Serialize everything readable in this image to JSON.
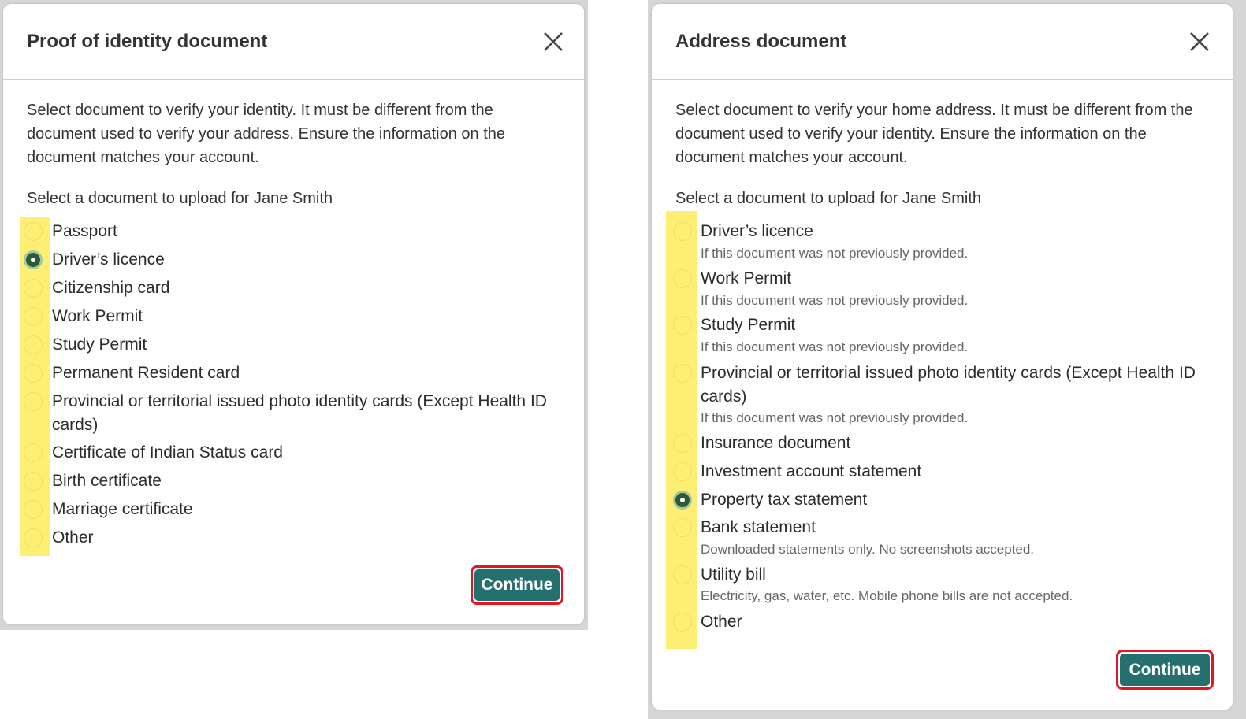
{
  "colors": {
    "highlight": "#fdef73",
    "primary_button": "#266f6f",
    "button_outline": "#e4161f",
    "radio_checked": "#2e5a38"
  },
  "identity_dialog": {
    "title": "Proof of identity document",
    "intro": "Select document to verify your identity. It must be different from the document used to verify your address. Ensure the information on the document matches your account.",
    "prompt": "Select a document to upload for Jane Smith",
    "options": [
      {
        "label": "Passport",
        "checked": false
      },
      {
        "label": "Driver’s licence",
        "checked": true
      },
      {
        "label": "Citizenship card",
        "checked": false
      },
      {
        "label": "Work Permit",
        "checked": false
      },
      {
        "label": "Study Permit",
        "checked": false
      },
      {
        "label": "Permanent Resident card",
        "checked": false
      },
      {
        "label": "Provincial or territorial issued photo identity cards (Except Health ID cards)",
        "checked": false
      },
      {
        "label": "Certificate of Indian Status card",
        "checked": false
      },
      {
        "label": "Birth certificate",
        "checked": false
      },
      {
        "label": "Marriage certificate",
        "checked": false
      },
      {
        "label": "Other",
        "checked": false
      }
    ],
    "continue_label": "Continue",
    "close_icon": "close-icon"
  },
  "address_dialog": {
    "title": "Address document",
    "intro": "Select document to verify your home address. It must be different from the document used to verify your identity. Ensure the information on the document matches your account.",
    "prompt": "Select a document to upload for Jane Smith",
    "options": [
      {
        "label": "Driver’s licence",
        "hint": "If this document was not previously provided.",
        "checked": false
      },
      {
        "label": "Work Permit",
        "hint": "If this document was not previously provided.",
        "checked": false
      },
      {
        "label": "Study Permit",
        "hint": "If this document was not previously provided.",
        "checked": false
      },
      {
        "label": "Provincial or territorial issued photo identity cards (Except Health ID cards)",
        "hint": "If this document was not previously provided.",
        "checked": false
      },
      {
        "label": "Insurance document",
        "checked": false
      },
      {
        "label": "Investment account statement",
        "checked": false
      },
      {
        "label": "Property tax statement",
        "checked": true
      },
      {
        "label": "Bank statement",
        "hint": "Downloaded statements only. No screenshots accepted.",
        "checked": false
      },
      {
        "label": "Utility bill",
        "hint": "Electricity, gas, water, etc. Mobile phone bills are not accepted.",
        "checked": false
      },
      {
        "label": "Other",
        "checked": false
      }
    ],
    "continue_label": "Continue",
    "close_icon": "close-icon"
  }
}
